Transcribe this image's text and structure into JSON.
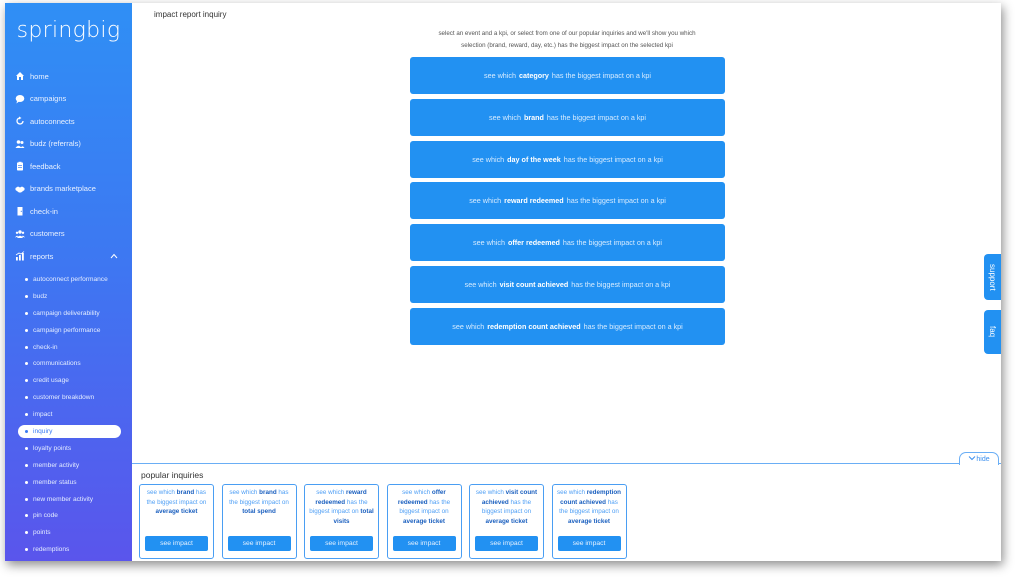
{
  "app": {
    "logo": "springbig"
  },
  "sidebar": {
    "items": [
      {
        "label": "home",
        "icon": "home-icon"
      },
      {
        "label": "campaigns",
        "icon": "chat-icon"
      },
      {
        "label": "autoconnects",
        "icon": "refresh-icon"
      },
      {
        "label": "budz (referrals)",
        "icon": "users-icon"
      },
      {
        "label": "feedback",
        "icon": "clipboard-icon"
      },
      {
        "label": "brands marketplace",
        "icon": "handshake-icon"
      },
      {
        "label": "check-in",
        "icon": "door-icon"
      },
      {
        "label": "customers",
        "icon": "group-icon"
      },
      {
        "label": "reports",
        "icon": "chart-icon"
      }
    ],
    "reports_sub": [
      "autoconnect performance",
      "budz",
      "campaign deliverability",
      "campaign performance",
      "check-in",
      "communications",
      "credit usage",
      "customer breakdown",
      "impact",
      "inquiry",
      "loyalty points",
      "member activity",
      "member status",
      "new member activity",
      "pin code",
      "points",
      "redemptions"
    ]
  },
  "main": {
    "title": "impact report inquiry",
    "instructions_line1": "select an event and a kpi, or select from one of our popular inquiries and we'll show you which",
    "instructions_line2": "selection (brand, reward, day, etc.) has the biggest impact on the selected kpi",
    "buttons": [
      {
        "pre": "see which",
        "key": "category",
        "post": "has the biggest impact on a kpi"
      },
      {
        "pre": "see which",
        "key": "brand",
        "post": "has the biggest impact on a kpi"
      },
      {
        "pre": "see which",
        "key": "day of the week",
        "post": "has the biggest impact on a kpi"
      },
      {
        "pre": "see which",
        "key": "reward redeemed",
        "post": "has the biggest impact on a kpi"
      },
      {
        "pre": "see which",
        "key": "offer redeemed",
        "post": "has the biggest impact on a kpi"
      },
      {
        "pre": "see which",
        "key": "visit count achieved",
        "post": "has the biggest impact on a kpi"
      },
      {
        "pre": "see which",
        "key": "redemption count achieved",
        "post": "has the biggest impact on a kpi"
      }
    ]
  },
  "side_tabs": {
    "support": "support",
    "faq": "faq"
  },
  "popular": {
    "title": "popular inquiries",
    "hide_label": "hide",
    "cards": [
      {
        "pre": "see which",
        "key": "brand",
        "mid": "has the biggest impact on",
        "kpi": "average ticket",
        "button": "see impact"
      },
      {
        "pre": "see which",
        "key": "brand",
        "mid": "has the biggest impact on",
        "kpi": "total spend",
        "button": "see impact"
      },
      {
        "pre": "see which",
        "key": "reward redeemed",
        "mid": "has the biggest impact on",
        "kpi": "total visits",
        "button": "see impact"
      },
      {
        "pre": "see which",
        "key": "offer redeemed",
        "mid": "has the biggest impact on",
        "kpi": "average ticket",
        "button": "see impact"
      },
      {
        "pre": "see which",
        "key": "visit count achieved",
        "mid": "has the biggest impact on",
        "kpi": "average ticket",
        "button": "see impact"
      },
      {
        "pre": "see which",
        "key": "redemption count achieved",
        "mid": "has the biggest impact on",
        "kpi": "average ticket",
        "button": "see impact"
      }
    ]
  },
  "colors": {
    "accent": "#2291f2",
    "sidebar_top": "#2f8ff5",
    "sidebar_bottom": "#5a55ec"
  }
}
